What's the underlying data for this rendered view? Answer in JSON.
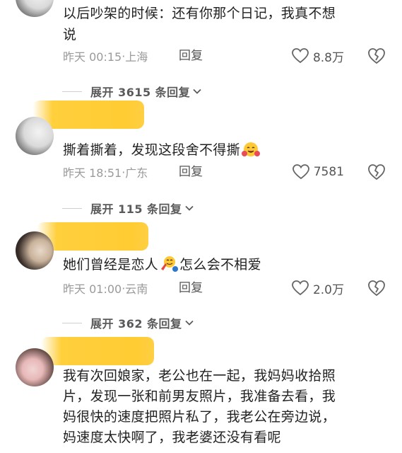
{
  "comments": [
    {
      "text_line1": "以后吵架的时候：还有你那个日记，我真不想",
      "text_line2": "说",
      "time": "昨天 00:15",
      "location": "上海",
      "reply_label": "回复",
      "likes": "8.8万"
    },
    {
      "text": "撕着撕着，发现这段舍不得撕",
      "time": "昨天 18:51",
      "location": "广东",
      "reply_label": "回复",
      "likes": "7581",
      "emoji": "red-hugging-face"
    },
    {
      "text_a": "她们曾经是恋人",
      "text_b": "怎么会不相爱",
      "time": "昨天 01:00",
      "location": "云南",
      "reply_label": "回复",
      "likes": "2.0万",
      "emoji": "bowling-pin-face"
    },
    {
      "text_line1": "我有次回娘家，老公也在一起，我妈妈收拾照",
      "text_line2": "片，发现一张和前男友照片，我准备去看，我",
      "text_line3": "妈很快的速度把照片私了，我老公在旁边说，",
      "text_line4": "妈速度太快啊了，我老婆还没有看呢"
    }
  ],
  "expand_labels": {
    "first": "展开 3615 条回复",
    "second": "展开 115 条回复",
    "third": "展开 362 条回复"
  },
  "separator": "·",
  "icons": {
    "like": "heart-outline-icon",
    "dislike": "broken-heart-icon",
    "expand": "chevron-down-icon"
  },
  "colors": {
    "mask": "#ffcc33",
    "meta": "#9a9a9a"
  }
}
